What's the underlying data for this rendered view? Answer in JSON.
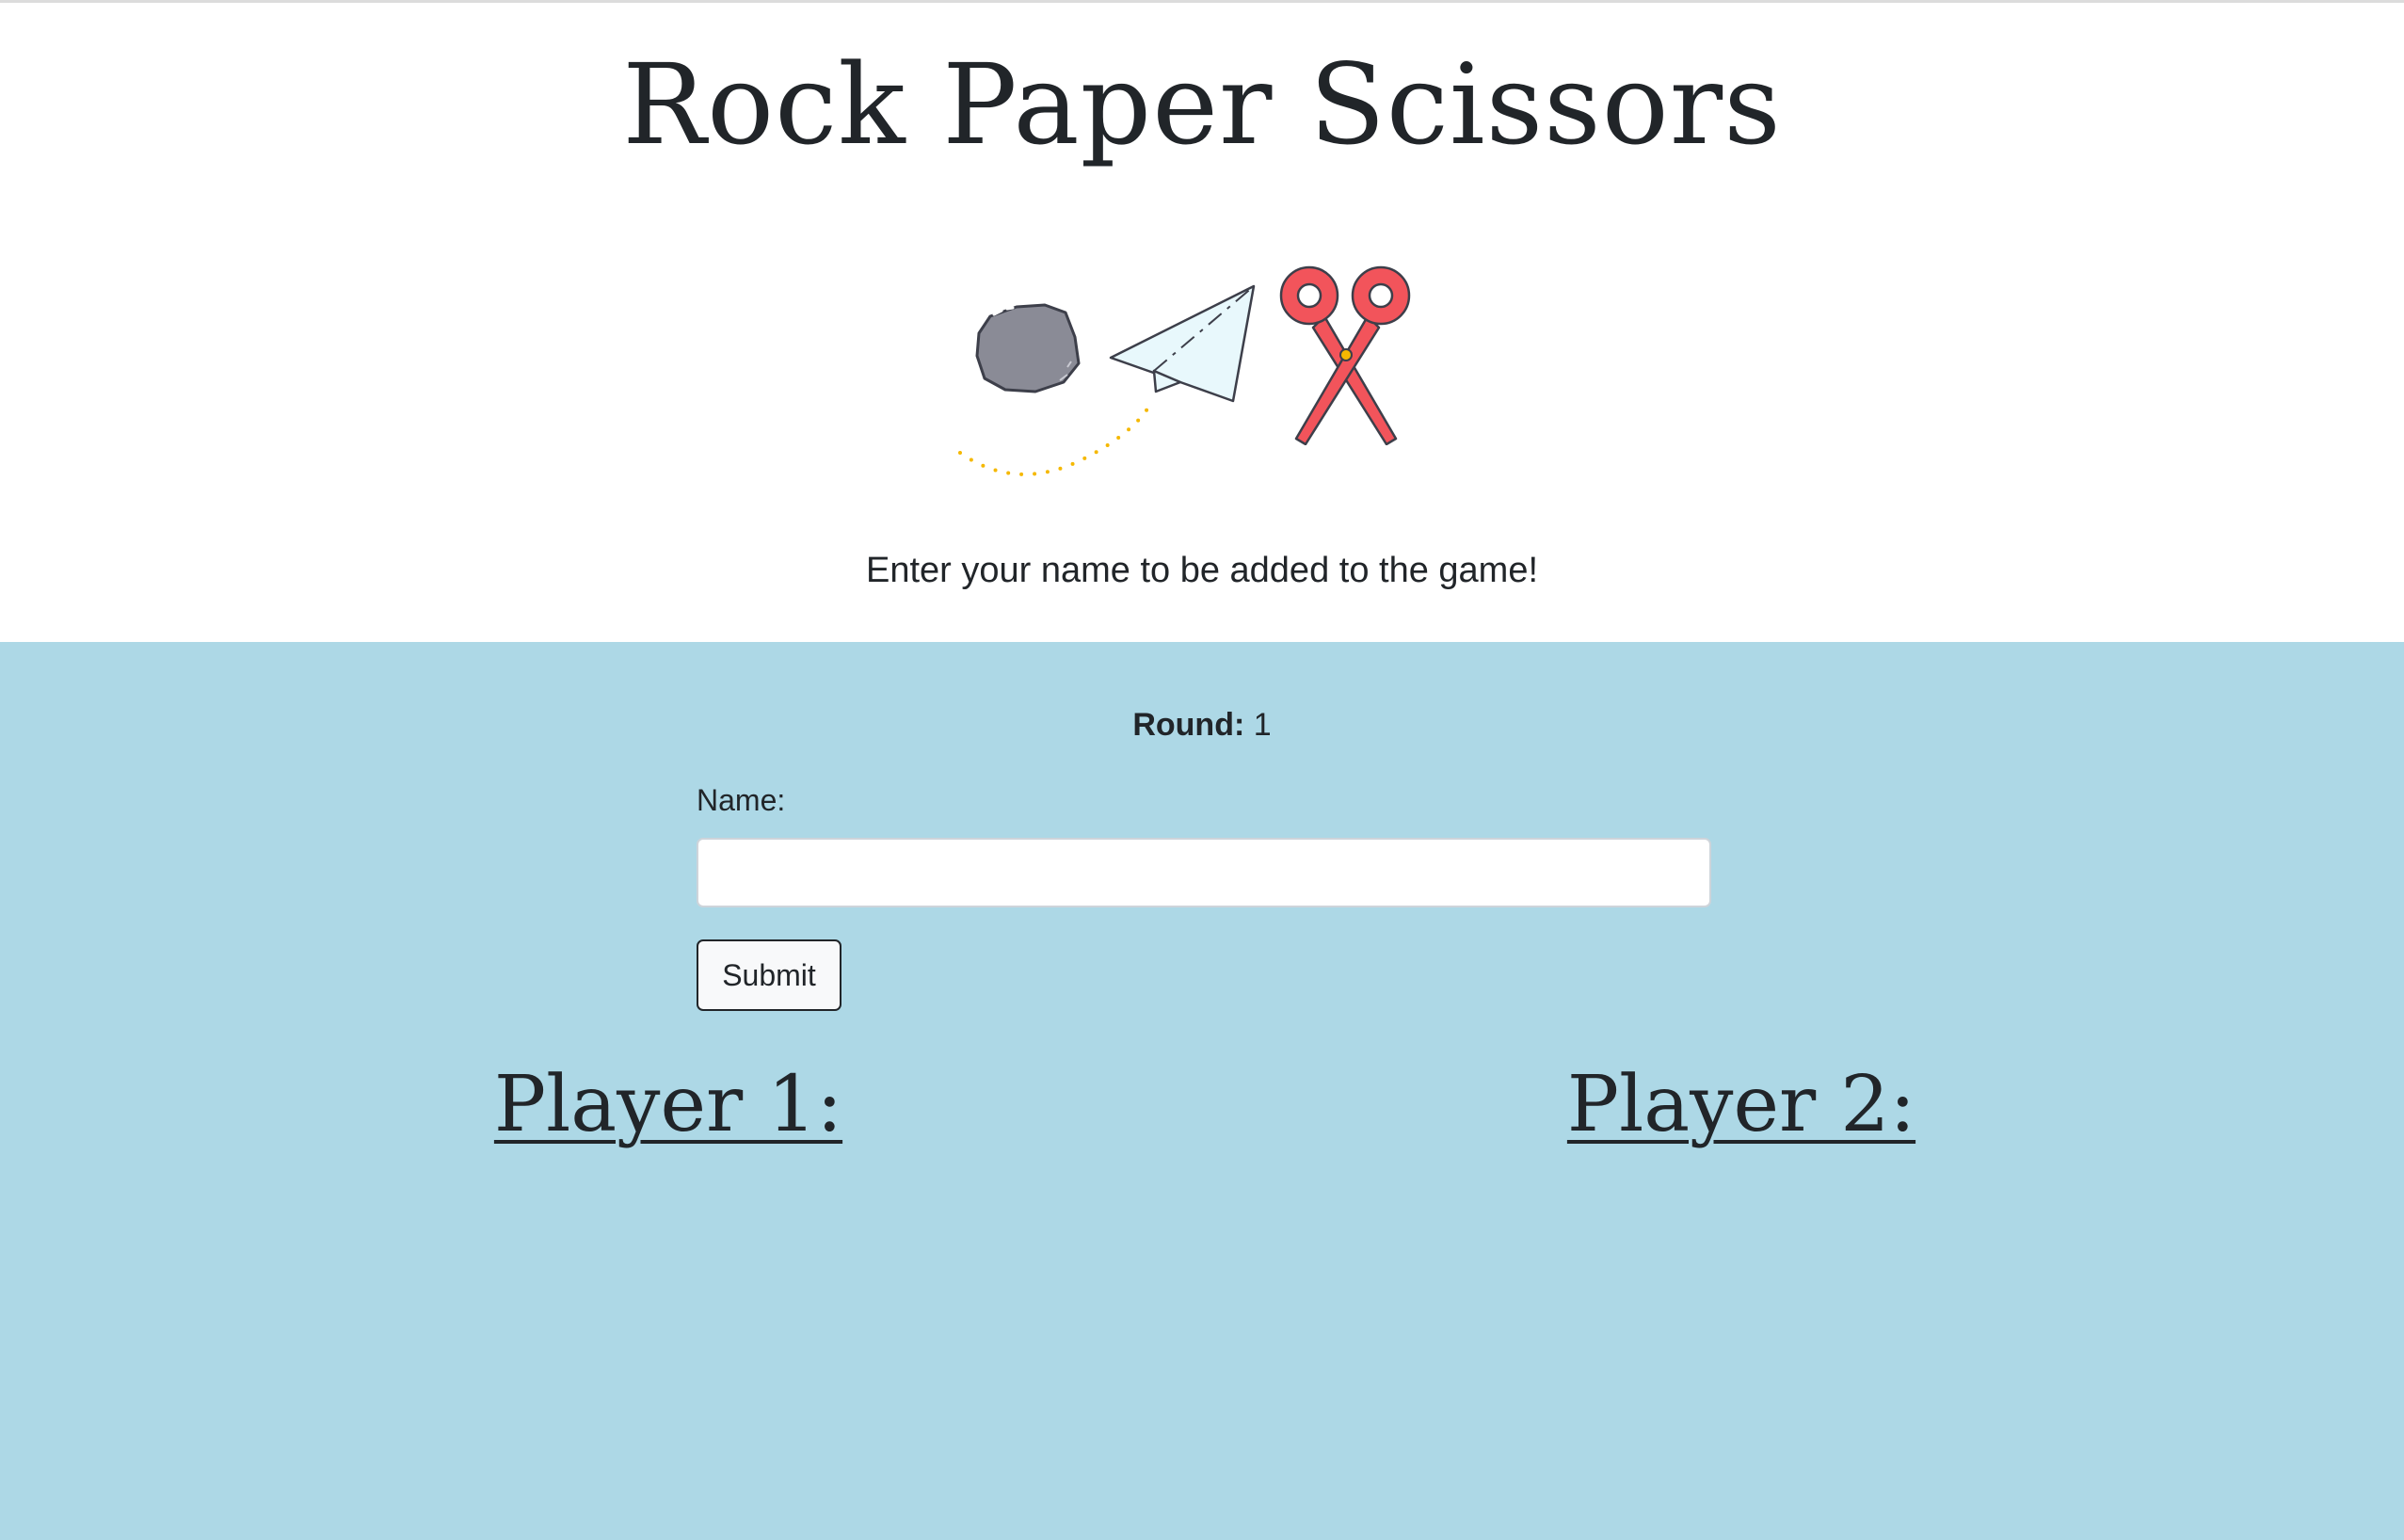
{
  "header": {
    "title": "Rock Paper Scissors",
    "subtitle": "Enter your name to be added to the game!",
    "hero_icons": [
      "rock-icon",
      "paper-plane-icon",
      "scissors-icon"
    ]
  },
  "game": {
    "round_label": "Round:",
    "round_value": "1",
    "name_label": "Name:",
    "name_value": "",
    "submit_label": "Submit",
    "player1_label": "Player 1:",
    "player2_label": "Player 2:"
  },
  "colors": {
    "game_background": "#add8e6",
    "header_background": "#ffffff",
    "text": "#212529",
    "rock": "#8a8b96",
    "paper": "#e8f8fc",
    "scissors": "#f2545b",
    "trail": "#f5b800"
  }
}
